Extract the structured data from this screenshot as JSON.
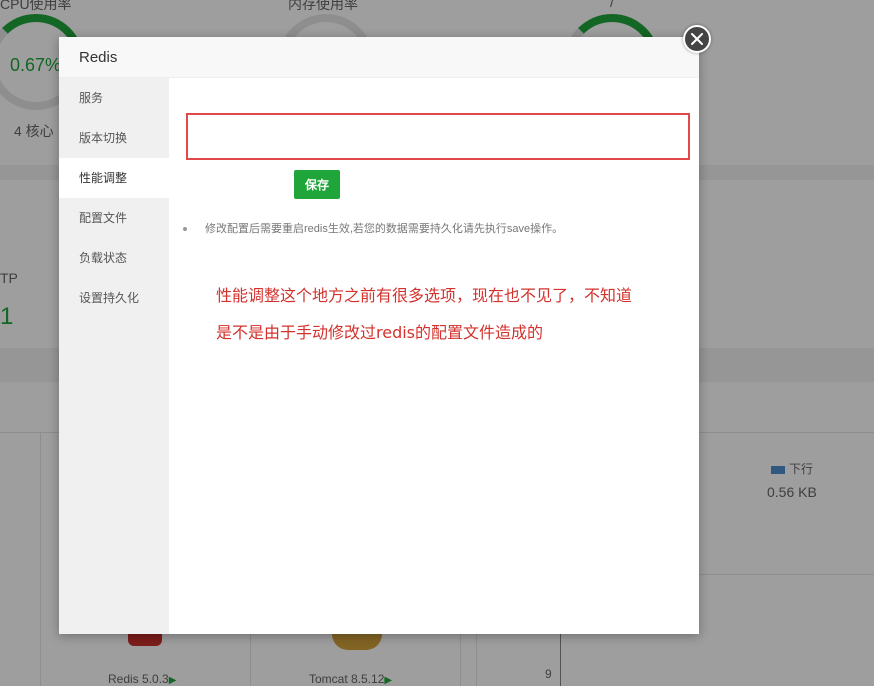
{
  "background": {
    "cpu_label": "CPU使用率",
    "cpu_value": "0.67%",
    "cpu_cores": "4 核心",
    "mem_label": "内存使用率",
    "third_gauge_label": "/",
    "left_partial_label": "TP",
    "left_partial_value": "1",
    "down_label": "下行",
    "down_value": "0.56 KB",
    "redis_app": "Redis 5.0.3",
    "tomcat_app": "Tomcat 8.5.12",
    "axis_tick": "9"
  },
  "modal": {
    "title": "Redis",
    "sidebar": [
      {
        "label": "服务"
      },
      {
        "label": "版本切换"
      },
      {
        "label": "性能调整"
      },
      {
        "label": "配置文件"
      },
      {
        "label": "负载状态"
      },
      {
        "label": "设置持久化"
      }
    ],
    "save_label": "保存",
    "tip": "修改配置后需要重启redis生效,若您的数据需要持久化请先执行save操作。",
    "note_line1": "性能调整这个地方之前有很多选项，现在也不见了，不知道",
    "note_line2": "是不是由于手动修改过redis的配置文件造成的"
  },
  "colors": {
    "accent": "#20a53a",
    "highlight_border": "#e0484a",
    "note_text": "#d3322d"
  }
}
